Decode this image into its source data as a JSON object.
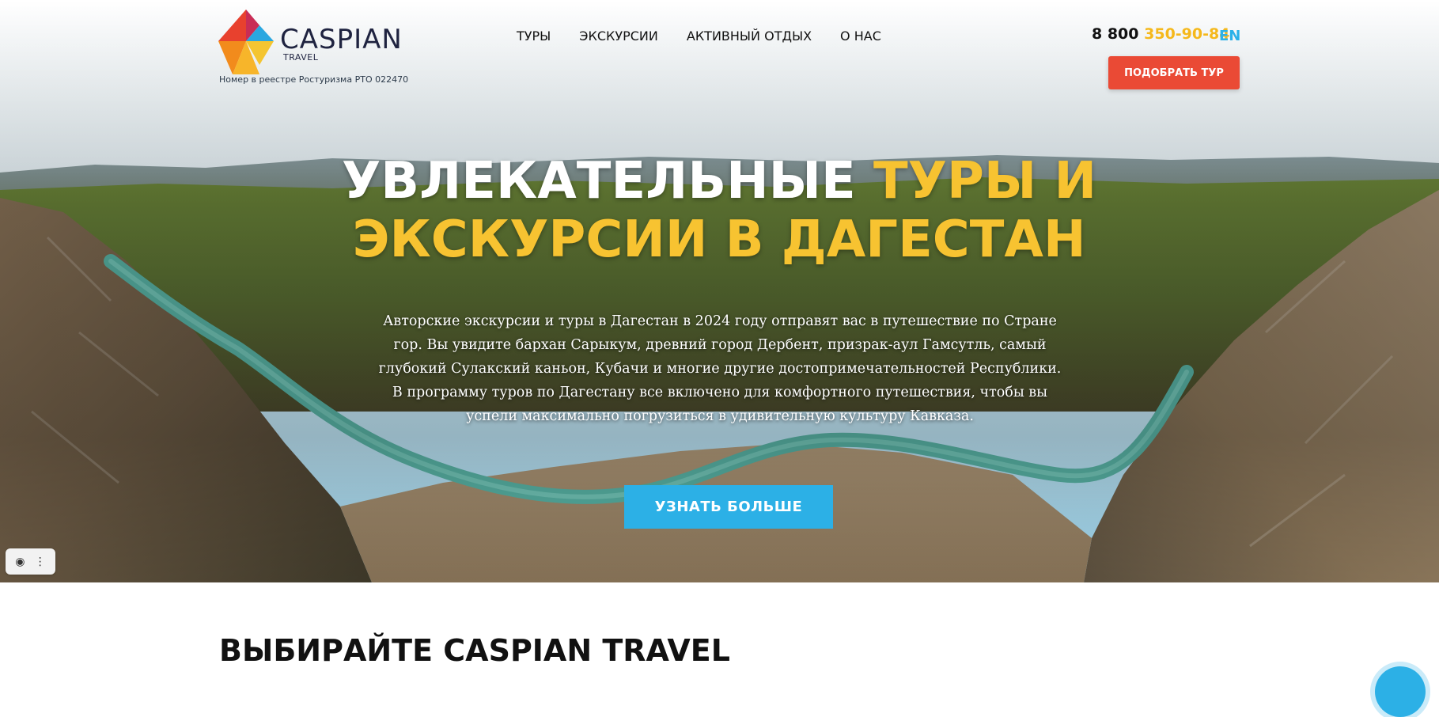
{
  "header": {
    "logo_name": "CASPIAN",
    "logo_sub": "TRAVEL",
    "registry_text": "Номер в реестре Ростуризма РТО 022470",
    "nav": [
      {
        "label": "ТУРЫ"
      },
      {
        "label": "ЭКСКУРСИИ"
      },
      {
        "label": "АКТИВНЫЙ ОТДЫХ"
      },
      {
        "label": "О НАС"
      }
    ],
    "phone_prefix": "8 800",
    "phone_number": "350-90-84",
    "lang": "EN",
    "cta_label": "ПОДОБРАТЬ ТУР"
  },
  "hero": {
    "headline_white": "УВЛЕКАТЕЛЬНЫЕ",
    "headline_yellow": "ТУРЫ И ЭКСКУРСИИ В ДАГЕСТАН",
    "intro": "Авторские экскурсии и туры в Дагестан в 2024 году отправят вас в путешествие по Стране гор. Вы увидите бархан Сарыкум, древний город Дербент, призрак-аул Гамсутль, самый глубокий Сулакский каньон, Кубачи и многие другие достопримечательностей Республики. В программу туров по Дагестану все включено для комфортного путешествия, чтобы вы успели максимально погрузиться в удивительную культуру Кавказа.",
    "button_label": "УЗНАТЬ БОЛЬШЕ"
  },
  "section": {
    "title": "ВЫБИРАЙТЕ CASPIAN TRAVEL"
  },
  "colors": {
    "accent_yellow": "#f7c331",
    "accent_blue": "#2cb0e6",
    "cta_red": "#ea4a35"
  },
  "icons": {
    "widget_left": "screenshot-icon",
    "widget_right": "more-vertical-icon",
    "chat": "chat-icon"
  }
}
